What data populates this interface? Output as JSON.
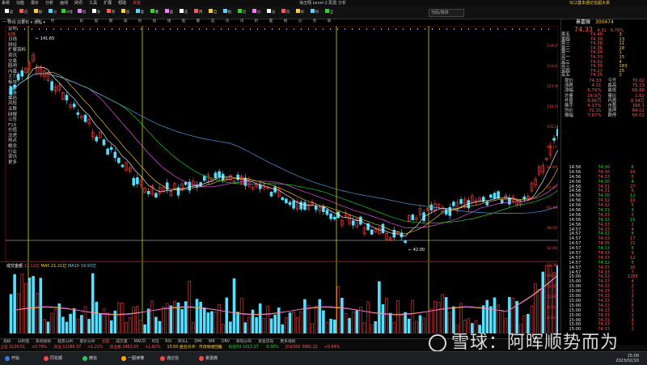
{
  "menubar": {
    "items": [
      "系统",
      "功能",
      "报价",
      "分析",
      "画线",
      "财讯",
      "工具",
      "扩展",
      "帮助",
      "资金"
    ],
    "title": "海玉翔 Level-2 配置 分析",
    "right_labels": [
      "SC2基本",
      "通达信超大单"
    ]
  },
  "toolbar": {
    "items": [
      "返回",
      "首页",
      "报价",
      "分时",
      "K线",
      "指标",
      "多股",
      "周期",
      "加减",
      "复权",
      "叠加",
      "画线",
      "选股",
      "预警",
      "自选",
      "板块",
      "资讯",
      "分析",
      "设置",
      "风格",
      "拆分",
      "财务",
      "全屏"
    ],
    "search_placeholder": "代码/简拼"
  },
  "subbar": {
    "label": "一 日线 前复权 ▾ 涨幅 ▾"
  },
  "left_tabs": [
    {
      "label": "分时",
      "on": false
    },
    {
      "label": "K线",
      "on": true
    },
    {
      "label": "日线",
      "on": false
    },
    {
      "label": "财经",
      "on": false
    },
    {
      "label": "扩展资料",
      "on": false
    },
    {
      "label": "资讯",
      "on": false
    },
    {
      "label": "交易",
      "on": false
    },
    {
      "label": "股吧",
      "on": false
    },
    {
      "label": "内幕",
      "on": false
    },
    {
      "label": "主力",
      "on": false
    },
    {
      "label": "板块",
      "on": false
    },
    {
      "label": "大单",
      "on": false
    },
    {
      "label": "资金",
      "on": false
    },
    {
      "label": "筹码",
      "on": false
    },
    {
      "label": "风险",
      "on": false
    },
    {
      "label": "关联",
      "on": false
    },
    {
      "label": "研报",
      "on": false
    },
    {
      "label": "公告",
      "on": false
    },
    {
      "label": "F10",
      "on": false
    },
    {
      "label": "价值",
      "on": false
    },
    {
      "label": "龙虎",
      "on": false
    },
    {
      "label": "热点",
      "on": false
    },
    {
      "label": "概念",
      "on": false
    },
    {
      "label": "行业",
      "on": false
    },
    {
      "label": "资讯",
      "on": false
    },
    {
      "label": "更多",
      "on": false
    }
  ],
  "chart_labels": {
    "high": "141.65",
    "low": "42.00",
    "price_axis": [
      "139.67",
      "131.63",
      "123.90",
      "116.50",
      "105.26",
      "93.71",
      "84.69",
      "72.47",
      "60.49",
      "48.59",
      "42.00"
    ],
    "vol_axis": [
      "23.38",
      "19.57",
      "15.76",
      "11.95",
      "8.14",
      "4.33"
    ]
  },
  "volume_label": {
    "name": "成交金额",
    "a": "13.12亿",
    "b": "MA5 21.21亿",
    "c": "MA10 19.93亿"
  },
  "right_panel": {
    "code": "300474",
    "name": "景嘉微",
    "price": "74.33",
    "change": "4.31",
    "pct": "6.76%",
    "sell": [
      {
        "label": "卖五",
        "price": "74.40",
        "vol": "3"
      },
      {
        "label": "卖四",
        "price": "74.39",
        "vol": "13"
      },
      {
        "label": "卖三",
        "price": "74.38",
        "vol": "11"
      },
      {
        "label": "卖二",
        "price": "74.36",
        "vol": "18"
      },
      {
        "label": "卖一",
        "price": "74.34",
        "vol": "1"
      }
    ],
    "buy": [
      {
        "label": "买一",
        "price": "74.33",
        "vol": "15"
      },
      {
        "label": "买二",
        "price": "74.32",
        "vol": "4"
      },
      {
        "label": "买三",
        "price": "74.30",
        "vol": "183"
      },
      {
        "label": "买四",
        "price": "74.27",
        "vol": "25"
      },
      {
        "label": "买五",
        "price": "74.25",
        "vol": "2"
      }
    ],
    "stats": [
      {
        "l": "现价",
        "v": "74.33",
        "l2": "今开",
        "v2": "70.02"
      },
      {
        "l": "涨跌",
        "v": "4.31",
        "l2": "最高",
        "v2": "75.23"
      },
      {
        "l": "涨幅",
        "v": "6.76%",
        "l2": "最低",
        "v2": "69.88"
      },
      {
        "l": "总量",
        "v": "18.9万",
        "l2": "量比",
        "v2": "1.62"
      },
      {
        "l": "外盘",
        "v": "9.56万",
        "l2": "内盘",
        "v2": "9.34万"
      },
      {
        "l": "换手",
        "v": "4.17%",
        "l2": "市盈",
        "v2": "166.1"
      },
      {
        "l": "均价",
        "v": "72.31",
        "l2": "涨停",
        "v2": "84.02"
      },
      {
        "l": "振幅",
        "v": "7.67%",
        "l2": "跌停",
        "v2": "56.02"
      }
    ]
  },
  "ticks": [
    {
      "t": "14:56",
      "p": "74.30",
      "v": "6",
      "c": "green"
    },
    {
      "t": "14:56",
      "p": "74.30",
      "v": "10",
      "c": "red"
    },
    {
      "t": "14:56",
      "p": "74.33",
      "v": "5",
      "c": "red"
    },
    {
      "t": "14:56",
      "p": "74.30",
      "v": "4",
      "c": "green"
    },
    {
      "t": "14:56",
      "p": "74.31",
      "v": "27",
      "c": "red"
    },
    {
      "t": "14:56",
      "p": "74.31",
      "v": "6",
      "c": "red"
    },
    {
      "t": "14:56",
      "p": "74.30",
      "v": "12",
      "c": "green"
    },
    {
      "t": "14:56",
      "p": "74.32",
      "v": "10",
      "c": "red"
    },
    {
      "t": "14:56",
      "p": "74.32",
      "v": "5",
      "c": "red"
    },
    {
      "t": "14:56",
      "p": "74.31",
      "v": "9",
      "c": "green"
    },
    {
      "t": "14:56",
      "p": "74.33",
      "v": "3",
      "c": "red"
    },
    {
      "t": "14:56",
      "p": "74.32",
      "v": "15",
      "c": "green"
    },
    {
      "t": "14:56",
      "p": "74.33",
      "v": "2",
      "c": "red"
    },
    {
      "t": "14:57",
      "p": "74.33",
      "v": "4",
      "c": "red"
    },
    {
      "t": "14:57",
      "p": "74.32",
      "v": "8",
      "c": "green"
    },
    {
      "t": "14:57",
      "p": "74.33",
      "v": "17",
      "c": "red"
    },
    {
      "t": "14:57",
      "p": "74.35",
      "v": "21",
      "c": "red"
    },
    {
      "t": "14:57",
      "p": "74.33",
      "v": "6",
      "c": "green"
    },
    {
      "t": "14:57",
      "p": "74.33",
      "v": "9",
      "c": "red"
    },
    {
      "t": "14:57",
      "p": "74.33",
      "v": "12",
      "c": "red"
    },
    {
      "t": "14:57",
      "p": "74.32",
      "v": "5",
      "c": "green"
    },
    {
      "t": "14:57",
      "p": "74.33",
      "v": "30",
      "c": "red"
    },
    {
      "t": "14:57",
      "p": "74.33",
      "v": "7",
      "c": "red"
    },
    {
      "t": "15:00",
      "p": "74.33",
      "v": "1285",
      "c": "red"
    },
    {
      "t": "15:00",
      "p": "74.33",
      "v": "4",
      "c": "red"
    },
    {
      "t": "15:00",
      "p": "74.33",
      "v": "2",
      "c": "red"
    },
    {
      "t": "15:00",
      "p": "74.33",
      "v": "1",
      "c": "red"
    },
    {
      "t": "15:00",
      "p": "74.33",
      "v": "3",
      "c": "red"
    },
    {
      "t": "15:00",
      "p": "74.33",
      "v": "2",
      "c": "red"
    },
    {
      "t": "15:00",
      "p": "74.33",
      "v": "5",
      "c": "red"
    },
    {
      "t": "15:00",
      "p": "74.33",
      "v": "1",
      "c": "red"
    },
    {
      "t": "15:00",
      "p": "74.33",
      "v": "2",
      "c": "red"
    },
    {
      "t": "15:00",
      "p": "74.33",
      "v": "3",
      "c": "red"
    },
    {
      "t": "15:00",
      "p": "74.33",
      "v": "1",
      "c": "red"
    },
    {
      "t": "15:00",
      "p": "74.33",
      "v": "2",
      "c": "red"
    }
  ],
  "bottom_tabs": [
    {
      "label": "指标",
      "on": false
    },
    {
      "label": "分析图",
      "on": false
    },
    {
      "label": "系统指标",
      "on": false
    },
    {
      "label": "趋势分析",
      "on": false
    },
    {
      "label": "量价分析",
      "on": false
    },
    {
      "label": "主图",
      "on": true
    },
    {
      "label": "成交量",
      "on": false
    },
    {
      "label": "MACD",
      "on": false
    },
    {
      "label": "KDJ",
      "on": false
    },
    {
      "label": "RSI",
      "on": false
    },
    {
      "label": "BOLL",
      "on": false
    },
    {
      "label": "DMI",
      "on": false
    },
    {
      "label": "WR",
      "on": false
    },
    {
      "label": "OBV",
      "on": false
    },
    {
      "label": "筹码分布",
      "on": false
    },
    {
      "label": "资金流向",
      "on": false
    },
    {
      "label": "更多指标",
      "on": false
    }
  ],
  "ticker": [
    {
      "t": "上证 3224.51",
      "c": "r"
    },
    {
      "t": "+0.79%",
      "c": "r"
    },
    {
      "t": "深证 12186.37",
      "c": "r"
    },
    {
      "t": "+1.21%",
      "c": "r"
    },
    {
      "t": "创业板 2461.55",
      "c": "r"
    },
    {
      "t": "+1.82%",
      "c": "r"
    },
    {
      "t": "15:00 盘后点评：市场情绪回暖",
      "c": "y"
    },
    {
      "t": "科创50 1013.27",
      "c": "g"
    },
    {
      "t": "-0.36%",
      "c": "g"
    },
    {
      "t": "沪深300 3981.22",
      "c": "r"
    },
    {
      "t": "+0.64%",
      "c": "r"
    }
  ],
  "taskbar": {
    "items": [
      "开始",
      "同花顺",
      "微信",
      "一图读懂",
      "通达信",
      "景嘉微"
    ],
    "time": "15:09",
    "date": "2023/02/10"
  },
  "watermark": "雪球：阿晖顺势而为"
}
